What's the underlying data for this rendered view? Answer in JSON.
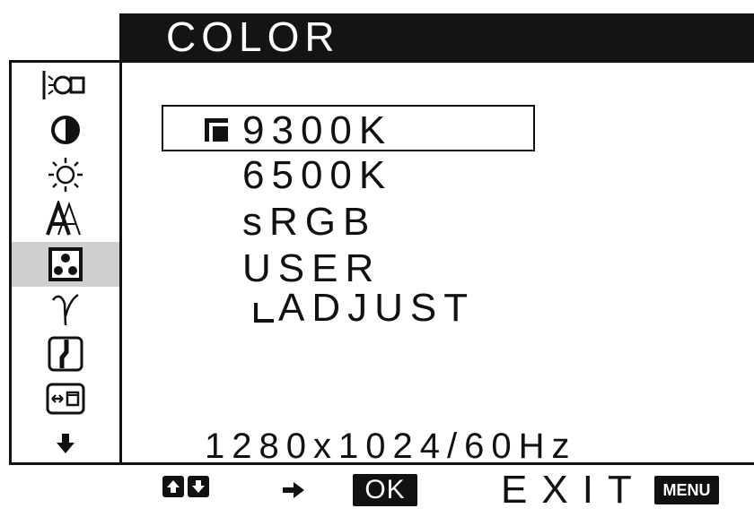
{
  "title": "COLOR",
  "sidebar": {
    "items": [
      {
        "icon": "backlight-icon"
      },
      {
        "icon": "contrast-icon"
      },
      {
        "icon": "brightness-icon"
      },
      {
        "icon": "sharpness-icon"
      },
      {
        "icon": "color-icon",
        "selected": true
      },
      {
        "icon": "gamma-icon"
      },
      {
        "icon": "zoom-icon"
      },
      {
        "icon": "screen-position-icon"
      },
      {
        "icon": "down-arrow-icon"
      }
    ]
  },
  "options": {
    "items": [
      "9300K",
      "6500K",
      "sRGB",
      "USER",
      "ADJUST"
    ],
    "selected": "9300K"
  },
  "resolution": "1280x1024/60Hz",
  "hints": {
    "ok_label": "OK",
    "exit_label": "EXIT",
    "menu_label": "MENU"
  }
}
